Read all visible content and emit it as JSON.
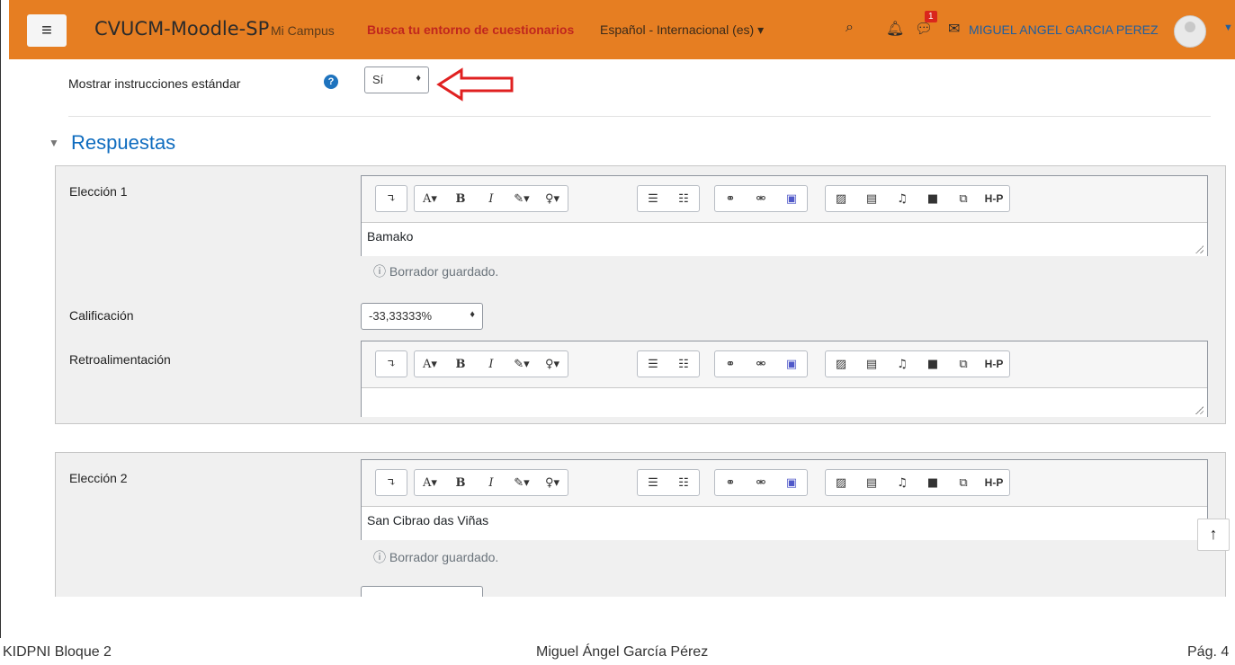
{
  "navbar": {
    "menu_icon": "menu-icon",
    "brand": "CVUCM-Moodle-SP",
    "mi_campus": "Mi Campus",
    "busca": "Busca tu entorno de cuestionarios",
    "language": "Español - Internacional (es) ▾",
    "notification_count": "1",
    "user_name": "MIGUEL ANGEL GARCIA PEREZ",
    "accent_color": "#e67e22"
  },
  "instructions": {
    "label": "Mostrar instrucciones estándar",
    "value": "Sí"
  },
  "section": {
    "title": "Respuestas"
  },
  "choice1": {
    "label": "Elección 1",
    "answer": "Bamako",
    "draft": "Borrador guardado.",
    "grade_label": "Calificación",
    "grade_value": "-33,33333%",
    "feedback_label": "Retroalimentación",
    "feedback_value": ""
  },
  "choice2": {
    "label": "Elección 2",
    "answer": "San Cibrao das Viñas",
    "draft": "Borrador guardado."
  },
  "toolbar": {
    "b": "B",
    "i": "I",
    "a": "A▾",
    "h5p": "H-P"
  },
  "footer": {
    "left": "KIDPNI Bloque 2",
    "center": "Miguel Ángel García Pérez",
    "right": "Pág. 4"
  }
}
